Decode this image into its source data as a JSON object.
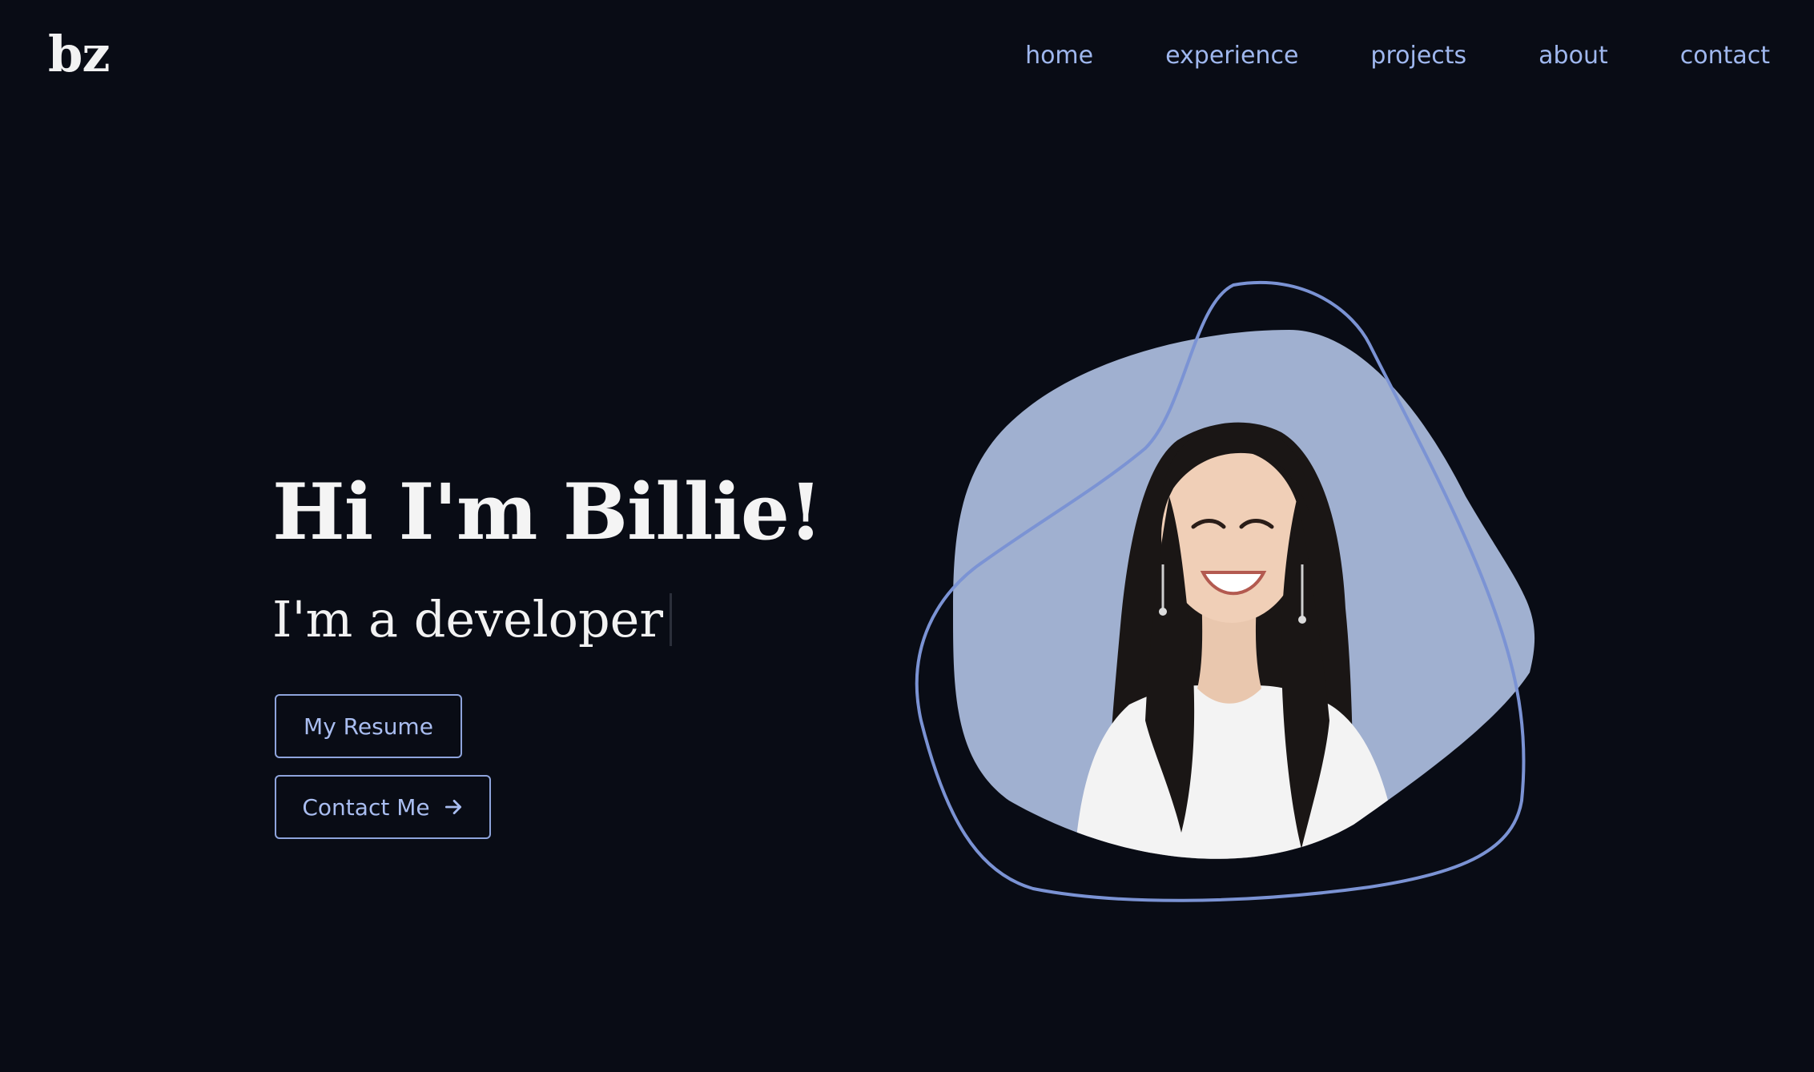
{
  "logo": "bz",
  "nav": {
    "items": [
      "home",
      "experience",
      "projects",
      "about",
      "contact"
    ]
  },
  "hero": {
    "title": "Hi I'm Billie!",
    "subtitle": "I'm a developer",
    "resume_label": "My Resume",
    "contact_label": "Contact Me"
  },
  "colors": {
    "background": "#090c15",
    "accent": "#9fb7ee",
    "blob_fill": "#a0b0d0",
    "blob_outline": "#7b93d4"
  },
  "icons": {
    "contact_arrow": "arrow-right-icon"
  }
}
